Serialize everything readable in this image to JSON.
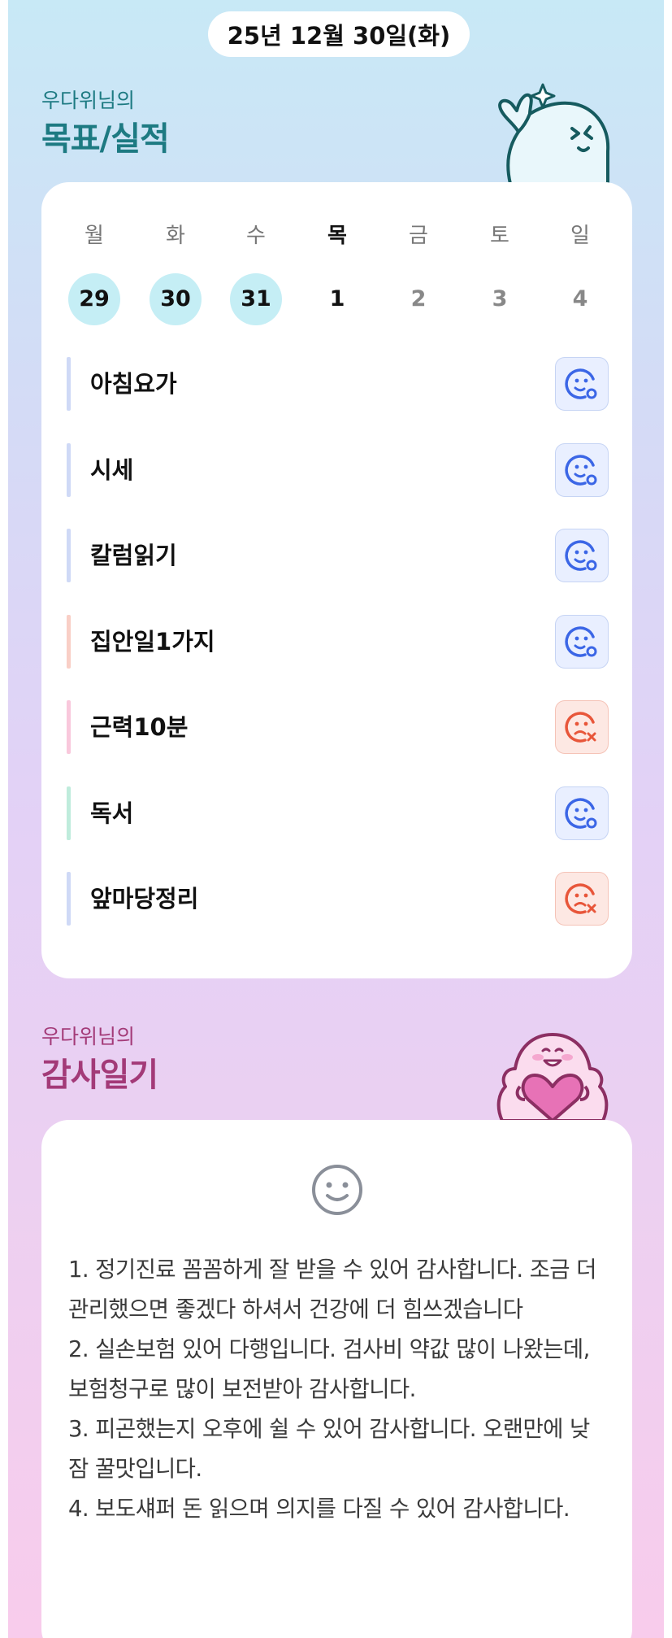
{
  "date": "25년 12월 30일(화)",
  "goals_section": {
    "subtitle": "우다위님의",
    "title": "목표/실적"
  },
  "week": {
    "days": [
      {
        "name": "월",
        "num": "29",
        "state": "done"
      },
      {
        "name": "화",
        "num": "30",
        "state": "done"
      },
      {
        "name": "수",
        "num": "31",
        "state": "done"
      },
      {
        "name": "목",
        "num": "1",
        "state": "current"
      },
      {
        "name": "금",
        "num": "2",
        "state": "future"
      },
      {
        "name": "토",
        "num": "3",
        "state": "future"
      },
      {
        "name": "일",
        "num": "4",
        "state": "future"
      }
    ]
  },
  "goals": [
    {
      "label": "아침요가",
      "status": "achieved",
      "bar_color": "#cfd9f6"
    },
    {
      "label": "시세",
      "status": "achieved",
      "bar_color": "#cfd9f6"
    },
    {
      "label": "칼럼읽기",
      "status": "achieved",
      "bar_color": "#cfd9f6"
    },
    {
      "label": "집안일1가지",
      "status": "achieved",
      "bar_color": "#f9cfc6"
    },
    {
      "label": "근력10분",
      "status": "missed",
      "bar_color": "#f9c8dc"
    },
    {
      "label": "독서",
      "status": "achieved",
      "bar_color": "#bfecdc"
    },
    {
      "label": "앞마당정리",
      "status": "missed",
      "bar_color": "#cfd9f6"
    }
  ],
  "gratitude_section": {
    "subtitle": "우다위님의",
    "title": "감사일기",
    "mood_icon": "smile-face-icon",
    "text": "1. 정기진료 꼼꼼하게 잘 받을 수 있어 감사합니다. 조금 더 관리했으면 좋겠다 하셔서 건강에 더 힘쓰겠습니다\n2. 실손보험 있어 다행입니다. 검사비 약값 많이 나왔는데, 보험청구로 많이 보전받아 감사합니다.\n3. 피곤했는지 오후에 쉴 수 있어 감사합니다. 오랜만에 낮잠 꿀맛입니다.\n4. 보도섀퍼 돈 읽으며 의지를 다질 수 있어 감사합니다."
  },
  "colors": {
    "goals_title": "#1d7a82",
    "gratitude_title": "#a33a78",
    "achieved_icon": "#3b66e6",
    "missed_icon": "#e8563a",
    "done_day_bg": "#c5eef5"
  }
}
